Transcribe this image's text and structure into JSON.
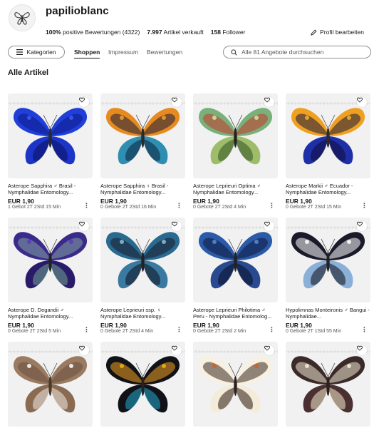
{
  "store": {
    "name": "papilioblanc",
    "logo_icon": "butterfly-logo-icon",
    "feedback_percent": "100%",
    "feedback_label": "positive Bewertungen (4322)",
    "sold_count": "7.997",
    "sold_label": "Artikel verkauft",
    "followers_count": "158",
    "followers_label": "Follower",
    "edit_profile": "Profil bearbeiten"
  },
  "nav": {
    "categories_label": "Kategorien",
    "tabs": [
      {
        "label": "Shoppen",
        "active": true
      },
      {
        "label": "Impressum",
        "active": false
      },
      {
        "label": "Bewertungen",
        "active": false
      }
    ],
    "search_placeholder": "Alle 81 Angebote durchsuchen"
  },
  "section_title": "Alle Artikel",
  "colors": {
    "accent_text": "#191919",
    "muted_text": "#555555",
    "image_bg": "#f1f1f1"
  },
  "items": [
    {
      "title": "Asterope Sapphira ♂ Brasil - Nymphalidae Entomology...",
      "price": "EUR 1,90",
      "meta": "1 Gebot 2T 2Std 15 Min",
      "fw": "#1f3fd8",
      "fw2": "#0c1a8a",
      "hw": "#1d34c8",
      "hw2": "#0a1466",
      "body": "#2a2a2a",
      "spot": "#3b5cf0"
    },
    {
      "title": "Asterope Sapphira ♀ Brasil - Nymphalidae Entomology...",
      "price": "EUR 1,90",
      "meta": "0 Gebote 2T 2Std 16 Min",
      "fw": "#e78a20",
      "fw2": "#1c1f3a",
      "hw": "#2e8fb0",
      "hw2": "#0f2a4a",
      "body": "#2a2a2a",
      "spot": "#f0a030"
    },
    {
      "title": "Asterope Leprieuri Optima ♂ Nymphalidae Entomology...",
      "price": "EUR 1,90",
      "meta": "0 Gebote 2T 2Std 4 Min",
      "fw": "#7ab07a",
      "fw2": "#c63a2a",
      "hw": "#9dbd6a",
      "hw2": "#3a5a2a",
      "body": "#222",
      "spot": "#d9e3a0"
    },
    {
      "title": "Asterope Markii ♂ Ecuador - Nymphalidae Entomology...",
      "price": "EUR 1,90",
      "meta": "0 Gebote 2T 2Std 15 Min",
      "fw": "#f0a020",
      "fw2": "#1a1a40",
      "hw": "#1e2fa8",
      "hw2": "#101040",
      "body": "#2a2a2a",
      "spot": "#f3b030"
    },
    {
      "title": "Asterope D. Degandii ♂ Nymphalidae Entomology...",
      "price": "EUR 1,90",
      "meta": "0 Gebote 2T 2Std 5 Min",
      "fw": "#3a2a8a",
      "fw2": "#7fa0a0",
      "hw": "#2a1a6a",
      "hw2": "#6a9a8a",
      "body": "#222",
      "spot": "#5a3ac0"
    },
    {
      "title": "Asterope Leprieuri ssp. ♀ Nymphalidae Entomology...",
      "price": "EUR 1,90",
      "meta": "0 Gebote 2T 2Std 4 Min",
      "fw": "#2a6a90",
      "fw2": "#1a1a2a",
      "hw": "#3a7aa0",
      "hw2": "#101828",
      "body": "#222",
      "spot": "#8ac0d8"
    },
    {
      "title": "Asterope Leprieuri Philotima ♂ Peru - Nymphalidae Entomolog...",
      "price": "EUR 1,90",
      "meta": "0 Gebote 2T 2Std 2 Min",
      "fw": "#2a5aa8",
      "fw2": "#0f1a3a",
      "hw": "#2a4a90",
      "hw2": "#0a1230",
      "body": "#222",
      "spot": "#5a8ad0"
    },
    {
      "title": "Hypolimnas Monteironis ♂ Bangui - Nymphalidae...",
      "price": "EUR 1,90",
      "meta": "0 Gebote 2T 1Std 55 Min",
      "fw": "#1a1a2a",
      "fw2": "#ffffff",
      "hw": "#8ab0d8",
      "hw2": "#1a1a2a",
      "body": "#222",
      "spot": "#ffffff"
    },
    {
      "title": "",
      "price": "",
      "meta": "",
      "fw": "#9a7a60",
      "fw2": "#6a5040",
      "hw": "#8a6a50",
      "hw2": "#e8e0d8",
      "body": "#4a3a2a",
      "spot": "#ffffff"
    },
    {
      "title": "",
      "price": "",
      "meta": "",
      "fw": "#111118",
      "fw2": "#f0a020",
      "hw": "#111118",
      "hw2": "#20a0c0",
      "body": "#222",
      "spot": "#f0b020"
    },
    {
      "title": "",
      "price": "",
      "meta": "",
      "fw": "#f8f0e0",
      "fw2": "#3a2a20",
      "hw": "#f4ecd8",
      "hw2": "#3a2a20",
      "body": "#2a2020",
      "spot": "#d06020"
    },
    {
      "title": "",
      "price": "",
      "meta": "",
      "fw": "#3a2a2a",
      "fw2": "#f0e8d0",
      "hw": "#4a3030",
      "hw2": "#e8dcc0",
      "body": "#2a2020",
      "spot": "#f4ecd8"
    }
  ]
}
